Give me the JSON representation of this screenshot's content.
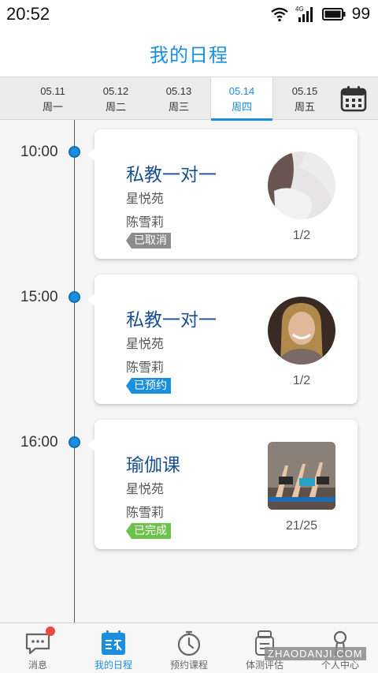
{
  "status_bar": {
    "time": "20:52",
    "network": "4G",
    "battery": "99"
  },
  "header": {
    "title": "我的日程"
  },
  "date_tabs": [
    {
      "date": "05.11",
      "weekday": "周一",
      "active": false
    },
    {
      "date": "05.12",
      "weekday": "周二",
      "active": false
    },
    {
      "date": "05.13",
      "weekday": "周三",
      "active": false
    },
    {
      "date": "05.14",
      "weekday": "周四",
      "active": true
    },
    {
      "date": "05.15",
      "weekday": "周五",
      "active": false
    }
  ],
  "calendar_icon": "calendar-icon",
  "schedule": [
    {
      "time": "10:00",
      "title": "私教一对一",
      "place": "星悦苑",
      "coach": "陈雪莉",
      "status": "已取消",
      "status_type": "cancel",
      "count": "1/2"
    },
    {
      "time": "15:00",
      "title": "私教一对一",
      "place": "星悦苑",
      "coach": "陈雪莉",
      "status": "已预约",
      "status_type": "booked",
      "count": "1/2"
    },
    {
      "time": "16:00",
      "title": "瑜伽课",
      "place": "星悦苑",
      "coach": "陈雪莉",
      "status": "已完成",
      "status_type": "done",
      "count": "21/25"
    }
  ],
  "bottom_nav": [
    {
      "label": "消息",
      "icon": "message-icon",
      "active": false
    },
    {
      "label": "我的日程",
      "icon": "schedule-icon",
      "active": true
    },
    {
      "label": "预约课程",
      "icon": "stopwatch-icon",
      "active": false
    },
    {
      "label": "体测评估",
      "icon": "assessment-icon",
      "active": false
    },
    {
      "label": "个人中心",
      "icon": "profile-icon",
      "active": false
    }
  ],
  "watermark": "ZHAODANJI.COM",
  "colors": {
    "accent": "#1a8fe0",
    "title_text": "#1a4f8e",
    "cancel": "#8c8c8c",
    "booked": "#1a8fe0",
    "done": "#6dc24b",
    "notification": "#f0483e"
  }
}
